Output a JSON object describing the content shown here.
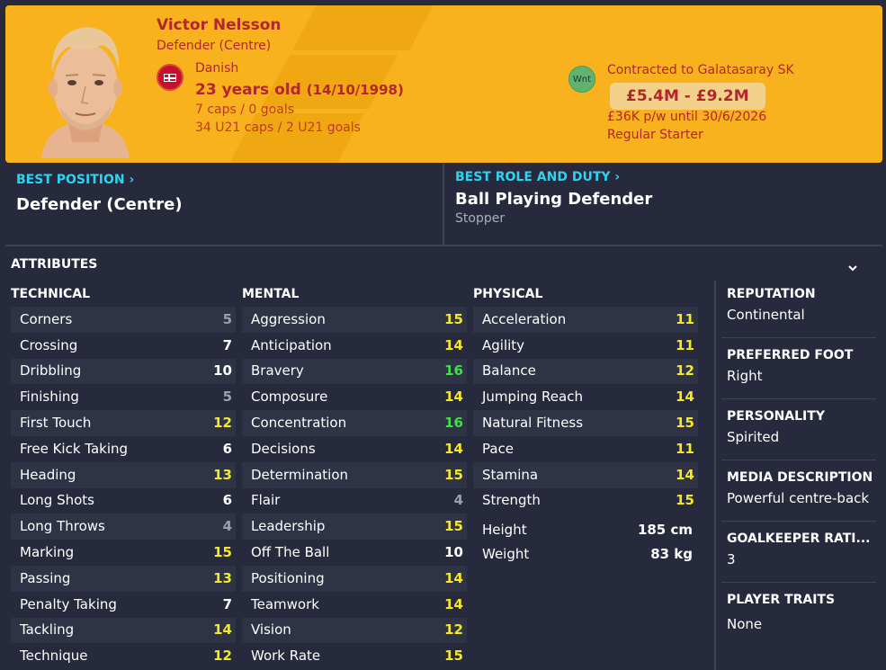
{
  "player": {
    "name": "Victor Nelsson",
    "position": "Defender (Centre)",
    "nationality": "Danish",
    "age": "23 years old",
    "dob": "(14/10/1998)",
    "caps": "7 caps / 0 goals",
    "u21": "34 U21 caps / 2 U21 goals"
  },
  "contract": {
    "badge": "Wnt",
    "club_text": "Contracted to Galatasaray SK",
    "value_range": "£5.4M - £9.2M",
    "wage": "£36K p/w until 30/6/2026",
    "status": "Regular Starter"
  },
  "best_position": {
    "title": "BEST POSITION",
    "value": "Defender (Centre)"
  },
  "best_role": {
    "title": "BEST ROLE AND DUTY",
    "role": "Ball Playing Defender",
    "duty": "Stopper"
  },
  "attributes": {
    "title": "ATTRIBUTES",
    "technical": {
      "title": "TECHNICAL",
      "items": [
        {
          "label": "Corners",
          "value": "5"
        },
        {
          "label": "Crossing",
          "value": "7"
        },
        {
          "label": "Dribbling",
          "value": "10"
        },
        {
          "label": "Finishing",
          "value": "5"
        },
        {
          "label": "First Touch",
          "value": "12"
        },
        {
          "label": "Free Kick Taking",
          "value": "6"
        },
        {
          "label": "Heading",
          "value": "13"
        },
        {
          "label": "Long Shots",
          "value": "6"
        },
        {
          "label": "Long Throws",
          "value": "4"
        },
        {
          "label": "Marking",
          "value": "15"
        },
        {
          "label": "Passing",
          "value": "13"
        },
        {
          "label": "Penalty Taking",
          "value": "7"
        },
        {
          "label": "Tackling",
          "value": "14"
        },
        {
          "label": "Technique",
          "value": "12"
        }
      ]
    },
    "mental": {
      "title": "MENTAL",
      "items": [
        {
          "label": "Aggression",
          "value": "15"
        },
        {
          "label": "Anticipation",
          "value": "14"
        },
        {
          "label": "Bravery",
          "value": "16"
        },
        {
          "label": "Composure",
          "value": "14"
        },
        {
          "label": "Concentration",
          "value": "16"
        },
        {
          "label": "Decisions",
          "value": "14"
        },
        {
          "label": "Determination",
          "value": "15"
        },
        {
          "label": "Flair",
          "value": "4"
        },
        {
          "label": "Leadership",
          "value": "15"
        },
        {
          "label": "Off The Ball",
          "value": "10"
        },
        {
          "label": "Positioning",
          "value": "14"
        },
        {
          "label": "Teamwork",
          "value": "14"
        },
        {
          "label": "Vision",
          "value": "12"
        },
        {
          "label": "Work Rate",
          "value": "15"
        }
      ]
    },
    "physical": {
      "title": "PHYSICAL",
      "items": [
        {
          "label": "Acceleration",
          "value": "11"
        },
        {
          "label": "Agility",
          "value": "11"
        },
        {
          "label": "Balance",
          "value": "12"
        },
        {
          "label": "Jumping Reach",
          "value": "14"
        },
        {
          "label": "Natural Fitness",
          "value": "15"
        },
        {
          "label": "Pace",
          "value": "11"
        },
        {
          "label": "Stamina",
          "value": "14"
        },
        {
          "label": "Strength",
          "value": "15"
        }
      ],
      "height_label": "Height",
      "height": "185 cm",
      "weight_label": "Weight",
      "weight": "83 kg"
    }
  },
  "side": {
    "reputation_title": "REPUTATION",
    "reputation": "Continental",
    "foot_title": "PREFERRED FOOT",
    "foot": "Right",
    "personality_title": "PERSONALITY",
    "personality": "Spirited",
    "media_title": "MEDIA DESCRIPTION",
    "media": "Powerful centre-back",
    "gk_title": "GOALKEEPER RATI...",
    "gk": "3",
    "traits_title": "PLAYER TRAITS",
    "traits": "None"
  },
  "colors": {
    "header_bg": "#f7b21d",
    "accent_text": "#b3262b",
    "section_title": "#2ed3f2",
    "attr_low": "#9aa0ad",
    "attr_mid": "#ffffff",
    "attr_good": "#f5e82a",
    "attr_great": "#3fe04a"
  }
}
